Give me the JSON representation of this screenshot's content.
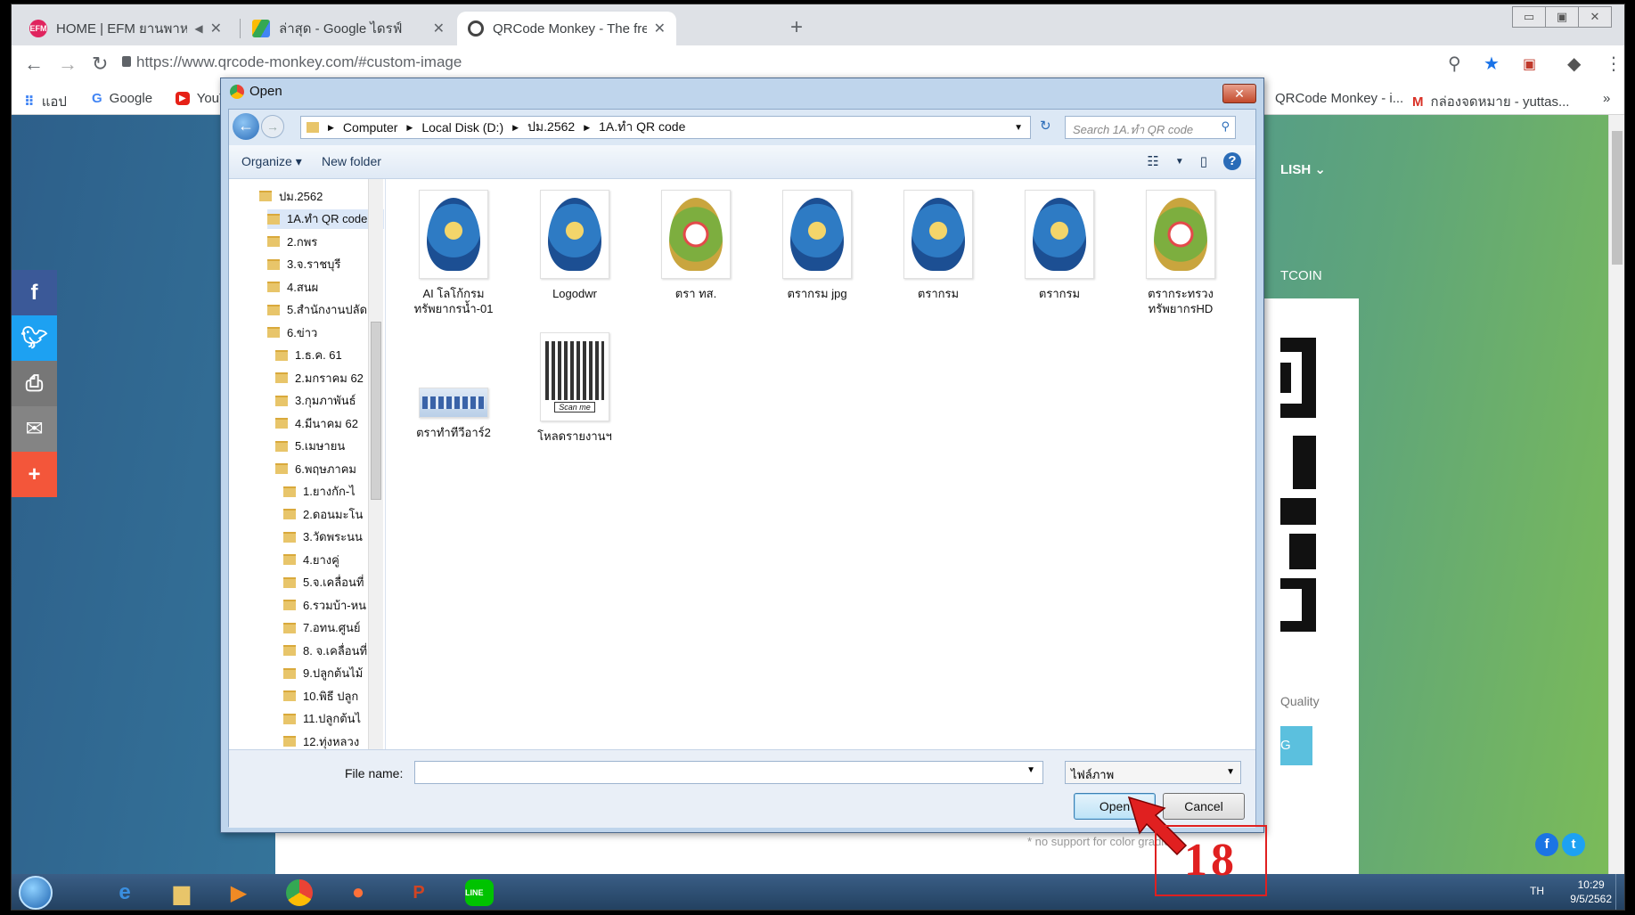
{
  "browser": {
    "tabs": [
      {
        "title": "HOME | EFM ยานพาหนะ เพลงดัง",
        "active": false,
        "favicon_color": "#e0245e"
      },
      {
        "title": "ล่าสุด - Google ไดรฟ์",
        "active": false,
        "favicon_color": "#fbbc05"
      },
      {
        "title": "QRCode Monkey - The free QR C",
        "active": true,
        "favicon_color": "#444444"
      }
    ],
    "new_tab": "+",
    "url": "https://www.qrcode-monkey.com/#custom-image",
    "window_controls": [
      "▭",
      "▣",
      "✕"
    ],
    "bookmarks": [
      {
        "label": "แอป",
        "icon": "apps-grid-icon"
      },
      {
        "label": "Google",
        "icon": "google-icon"
      },
      {
        "label": "YouTube",
        "icon": "youtube-icon"
      },
      {
        "label": "QRCode Monkey - i...",
        "icon": "qrcode-monkey-icon"
      },
      {
        "label": "กล่องจดหมาย - yuttas...",
        "icon": "gmail-icon"
      }
    ],
    "bookmarks_more": "»"
  },
  "page": {
    "language": "LISH ⌄",
    "coin_link": "TCOIN",
    "quality_label": "Quality",
    "create_button_partial": "G",
    "no_support_text": "* no support for color gradient",
    "social": [
      "f",
      "t",
      "print",
      "mail",
      "+"
    ]
  },
  "dialog": {
    "title": "Open",
    "close": "✕",
    "breadcrumb": [
      "Computer",
      "Local Disk (D:)",
      "ปม.2562",
      "1A.ทำ QR code"
    ],
    "search_placeholder": "Search 1A.ทำ QR code",
    "toolbar": {
      "organize": "Organize ▾",
      "new_folder": "New folder",
      "help": "?"
    },
    "tree": [
      {
        "label": "ปม.2562",
        "indent": 0
      },
      {
        "label": "1A.ทำ QR code",
        "indent": 1,
        "selected": true
      },
      {
        "label": "2.กพร",
        "indent": 1
      },
      {
        "label": "3.จ.ราชบุรี",
        "indent": 1
      },
      {
        "label": "4.สนผ",
        "indent": 1
      },
      {
        "label": "5.สำนักงานปลัด",
        "indent": 1
      },
      {
        "label": "6.ข่าว",
        "indent": 1
      },
      {
        "label": "1.ธ.ค. 61",
        "indent": 2
      },
      {
        "label": "2.มกราคม 62",
        "indent": 2
      },
      {
        "label": "3.กุมภาพันธ์",
        "indent": 2
      },
      {
        "label": "4.มีนาคม 62",
        "indent": 2
      },
      {
        "label": "5.เมษายน",
        "indent": 2
      },
      {
        "label": "6.พฤษภาคม",
        "indent": 2
      },
      {
        "label": "1.ยางกัก-ไ",
        "indent": 3
      },
      {
        "label": "2.ดอนมะโน",
        "indent": 3
      },
      {
        "label": "3.วัดพระนน",
        "indent": 3
      },
      {
        "label": "4.ยางคู่",
        "indent": 3
      },
      {
        "label": "5.จ.เคลื่อนที่",
        "indent": 3
      },
      {
        "label": "6.รวมบ้า-หน",
        "indent": 3
      },
      {
        "label": "7.อทน.ศูนย์",
        "indent": 3
      },
      {
        "label": "8. จ.เคลื่อนที่",
        "indent": 3
      },
      {
        "label": "9.ปลูกต้นไม้",
        "indent": 3
      },
      {
        "label": "10.พิธี ปลูก",
        "indent": 3
      },
      {
        "label": "11.ปลูกต้นไ",
        "indent": 3
      },
      {
        "label": "12.ทุ่งหลวง",
        "indent": 3
      }
    ],
    "files": [
      {
        "name": "AI โลโก้กรม ทรัพยากรน้ำ-01",
        "style": "blue"
      },
      {
        "name": "Logodwr",
        "style": "blue"
      },
      {
        "name": "ตรา ทส.",
        "style": "green"
      },
      {
        "name": "ตรากรม jpg",
        "style": "blue"
      },
      {
        "name": "ตรากรม",
        "style": "blue"
      },
      {
        "name": "ตรากรม",
        "style": "blue"
      },
      {
        "name": "ตรากระทรวง ทรัพยากรHD",
        "style": "green"
      },
      {
        "name": "ตราทำทีวีอาร์2",
        "style": "banner"
      },
      {
        "name": "โหลดรายงานฯ",
        "style": "qr"
      }
    ],
    "qr_caption": "Scan me",
    "file_name_label": "File name:",
    "file_name_value": "",
    "file_type": "ไฟล์ภาพ",
    "open_button": "Open",
    "cancel_button": "Cancel"
  },
  "annotation": {
    "step_number": "18",
    "color": "#e02020"
  },
  "taskbar": {
    "apps": [
      "start",
      "ie",
      "explorer",
      "media-player",
      "chrome",
      "firefox",
      "powerpoint",
      "line"
    ],
    "tray_lang": "TH",
    "time": "10:29",
    "date": "9/5/2562"
  }
}
